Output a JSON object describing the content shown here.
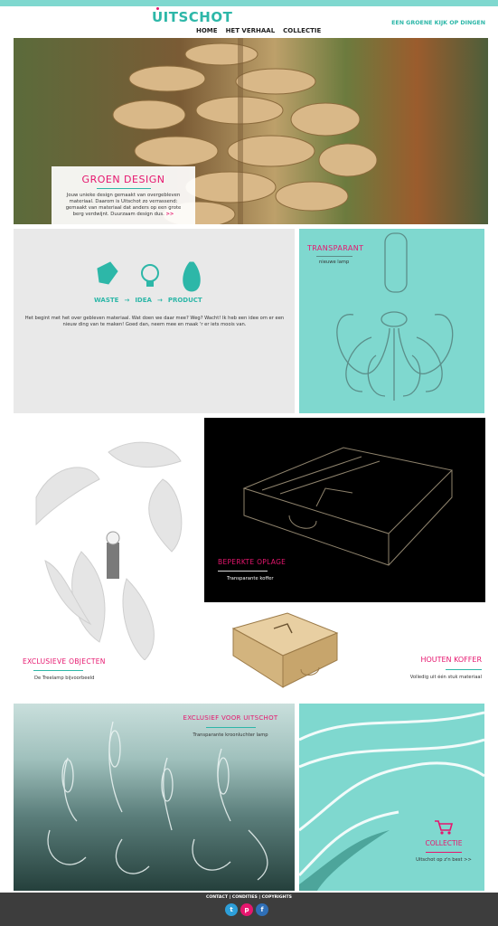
{
  "header": {
    "logo": "UITSCHOT",
    "nav": [
      "HOME",
      "HET VERHAAL",
      "COLLECTIE"
    ],
    "tagline": "EEN GROENE KIJK OP DINGEN"
  },
  "hero": {
    "title": "GROEN DESIGN",
    "text": "Jouw unieke design gemaakt van overgebleven materiaal. Daarom is Uitschot zo verrassend: gemaakt van materiaal dat anders op een grote berg verdwijnt. Duurzaam design dus.",
    "arrow": ">>"
  },
  "intro": {
    "steps": [
      "WASTE",
      "IDEA",
      "PRODUCT"
    ],
    "arrows": [
      "→",
      "→"
    ],
    "text": "Het begint met het over gebleven materiaal. Wat doen we daar mee? Weg? Wacht! Ik heb een idee om er een nieuw ding van te maken! Goed dan, neem mee en maak 'r er iets moois van."
  },
  "transparant": {
    "title": "TRANSPARANT",
    "subtitle": "nieuwe lamp"
  },
  "beperkt": {
    "title": "BEPERKTE OPLAGE",
    "subtitle": "Transparante koffer"
  },
  "exclusieve": {
    "title": "EXCLUSIEVE OBJECTEN",
    "subtitle": "De Treelamp bijvoorbeeld"
  },
  "houten": {
    "title": "HOUTEN KOFFER",
    "subtitle": "Volledig uit één stuk materiaal"
  },
  "exclusief": {
    "title": "EXCLUSIEF VOOR UITSCHOT",
    "subtitle": "Transparante kroonluchter lamp"
  },
  "collectie": {
    "title": "COLLECTIE",
    "subtitle": "Uitschot op z'n best >>"
  },
  "footer": {
    "links": "CONTACT | CONDITIES | COPYRIGHTS",
    "socials": [
      "t",
      "p",
      "f"
    ]
  },
  "colors": {
    "accent": "#2db7a8",
    "pink": "#e6166e",
    "turquoise": "#7fd8cf"
  }
}
